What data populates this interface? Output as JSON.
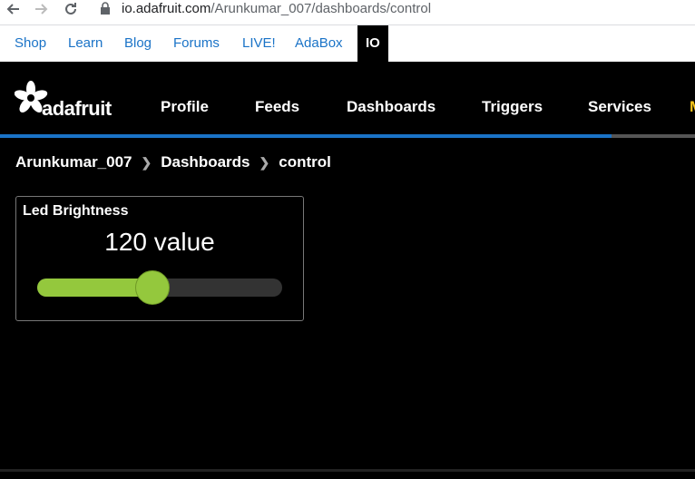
{
  "browser": {
    "url_host": "io.adafruit.com",
    "url_path": "/Arunkumar_007/dashboards/control"
  },
  "toplinks": [
    "Shop",
    "Learn",
    "Blog",
    "Forums",
    "LIVE!",
    "AdaBox",
    "IO"
  ],
  "header": {
    "logo_text": "adafruit",
    "nav": [
      "Profile",
      "Feeds",
      "Dashboards",
      "Triggers",
      "Services"
    ],
    "progress_fraction": 0.88,
    "colors": {
      "accent": "#1a73c7",
      "slider": "#94c83d"
    }
  },
  "breadcrumb": [
    "Arunkumar_007",
    "Dashboards",
    "control"
  ],
  "widget": {
    "title": "Led Brightness",
    "value_label": "120 value",
    "slider_fraction": 0.47
  }
}
